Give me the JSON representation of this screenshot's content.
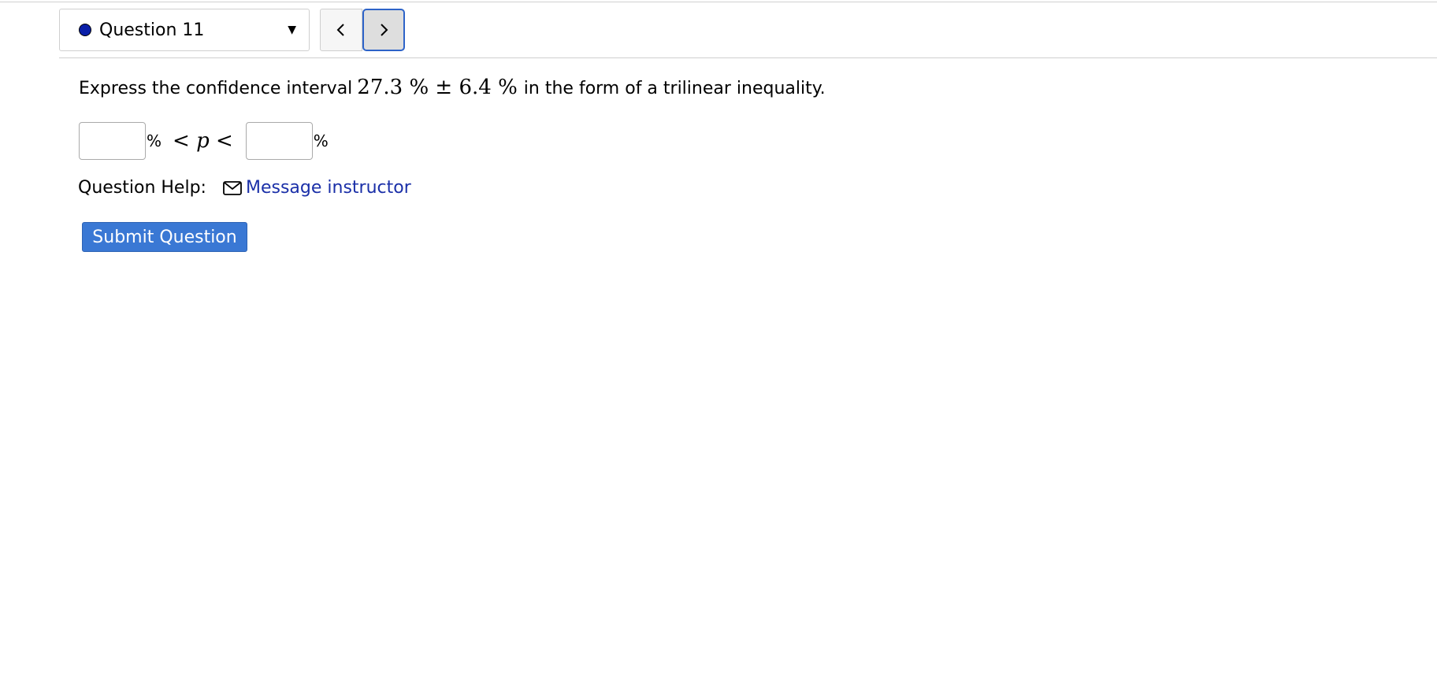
{
  "navigation": {
    "question_select": {
      "selected": "Question 11",
      "status_color": "#0a1fa8"
    },
    "prev_icon": "chevron-left-icon",
    "next_icon": "chevron-right-icon",
    "dropdown_icon": "caret-down-icon"
  },
  "question": {
    "prompt_before": "Express the confidence interval",
    "math_expression": "27.3 % ± 6.4 %",
    "prompt_after": "in the form of a trilinear inequality.",
    "answer": {
      "lower_value": "",
      "upper_value": "",
      "unit": "%",
      "middle_expression_left": "<",
      "variable": "p",
      "middle_expression_right": "<"
    }
  },
  "help": {
    "label": "Question Help:",
    "link_icon": "mail-icon",
    "link_text": "Message instructor"
  },
  "submit": {
    "label": "Submit Question",
    "color": "#3a78d4"
  },
  "colors": {
    "link": "#1a2fa8",
    "focus_border": "#2d63c8"
  }
}
